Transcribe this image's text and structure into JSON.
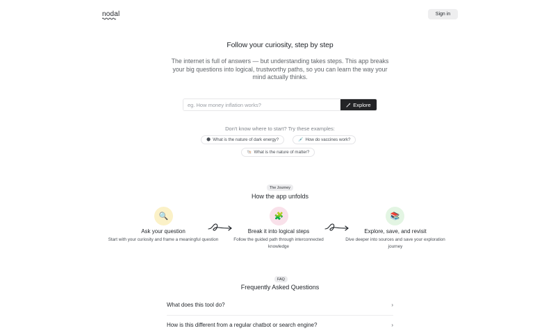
{
  "header": {
    "logo": "nodal",
    "signin_label": "Sign in"
  },
  "hero": {
    "title": "Follow your curiosity, step by step",
    "subtitle": "The internet is full of answers — but understanding takes steps. This app breaks your big questions into logical, trustworthy paths, so you can learn the way your mind actually thinks."
  },
  "search": {
    "placeholder": "eg. How money inflation works?",
    "value": "",
    "button_label": "Explore",
    "button_icon": "magic-wand-icon"
  },
  "examples": {
    "title": "Don't know where to start? Try these examples:",
    "items": [
      {
        "icon": "🌑",
        "label": "What is the nature of dark energy?"
      },
      {
        "icon": "💉",
        "label": "How do vaccines work?"
      },
      {
        "icon": "🐚",
        "label": "What is the nature of matter?"
      }
    ]
  },
  "journey": {
    "badge": "The Journey",
    "title": "How the app unfolds",
    "steps": [
      {
        "icon": "🔍",
        "icon_bg": "#fbf1c7",
        "title": "Ask your question",
        "desc": "Start with your curiosity and frame a meaningful question"
      },
      {
        "icon": "🧩",
        "icon_bg": "#f9e1ea",
        "title": "Break it into logical steps",
        "desc": "Follow the guided path through interconnected knowledge"
      },
      {
        "icon": "📚",
        "icon_bg": "#e3f5e3",
        "title": "Explore, save, and revisit",
        "desc": "Dive deeper into sources and save your exploration journey"
      }
    ]
  },
  "faq": {
    "badge": "FAQ",
    "title": "Frequently Asked Questions",
    "items": [
      {
        "question": "What does this tool do?"
      },
      {
        "question": "How is this different from a regular chatbot or search engine?"
      }
    ]
  }
}
